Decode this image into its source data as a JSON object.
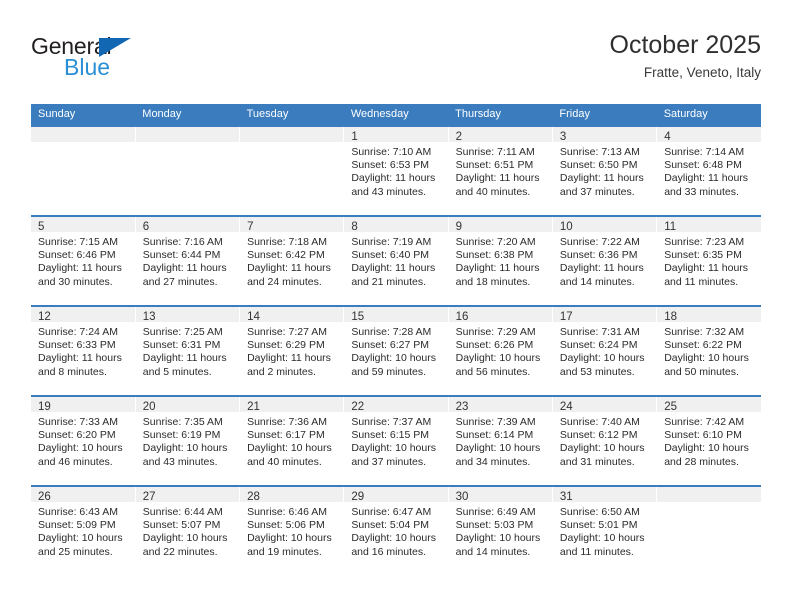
{
  "brand": {
    "name_part1": "General",
    "name_part2": "Blue",
    "triangle_icon": "brand-triangle-icon",
    "colors": {
      "dark": "#231f20",
      "blue": "#2a8fd4",
      "triangle": "#1267b2"
    }
  },
  "header": {
    "title": "October 2025",
    "subtitle": "Fratte, Veneto, Italy"
  },
  "theme": {
    "header_row_bg": "#3a7cbe",
    "daynum_band_bg": "#f0f0f0",
    "cell_bg": "#ffffff",
    "text": "#2b2b2b"
  },
  "weekday_headers": [
    "Sunday",
    "Monday",
    "Tuesday",
    "Wednesday",
    "Thursday",
    "Friday",
    "Saturday"
  ],
  "labels": {
    "sunrise_prefix": "Sunrise:",
    "sunset_prefix": "Sunset:",
    "daylight_prefix": "Daylight:"
  },
  "weeks": [
    [
      {
        "day": "",
        "empty": true,
        "l1": "",
        "l2": "",
        "l3": "",
        "l4": ""
      },
      {
        "day": "",
        "empty": true,
        "l1": "",
        "l2": "",
        "l3": "",
        "l4": ""
      },
      {
        "day": "",
        "empty": true,
        "l1": "",
        "l2": "",
        "l3": "",
        "l4": ""
      },
      {
        "day": "1",
        "empty": false,
        "l1": "Sunrise: 7:10 AM",
        "l2": "Sunset: 6:53 PM",
        "l3": "Daylight: 11 hours",
        "l4": "and 43 minutes."
      },
      {
        "day": "2",
        "empty": false,
        "l1": "Sunrise: 7:11 AM",
        "l2": "Sunset: 6:51 PM",
        "l3": "Daylight: 11 hours",
        "l4": "and 40 minutes."
      },
      {
        "day": "3",
        "empty": false,
        "l1": "Sunrise: 7:13 AM",
        "l2": "Sunset: 6:50 PM",
        "l3": "Daylight: 11 hours",
        "l4": "and 37 minutes."
      },
      {
        "day": "4",
        "empty": false,
        "l1": "Sunrise: 7:14 AM",
        "l2": "Sunset: 6:48 PM",
        "l3": "Daylight: 11 hours",
        "l4": "and 33 minutes."
      }
    ],
    [
      {
        "day": "5",
        "empty": false,
        "l1": "Sunrise: 7:15 AM",
        "l2": "Sunset: 6:46 PM",
        "l3": "Daylight: 11 hours",
        "l4": "and 30 minutes."
      },
      {
        "day": "6",
        "empty": false,
        "l1": "Sunrise: 7:16 AM",
        "l2": "Sunset: 6:44 PM",
        "l3": "Daylight: 11 hours",
        "l4": "and 27 minutes."
      },
      {
        "day": "7",
        "empty": false,
        "l1": "Sunrise: 7:18 AM",
        "l2": "Sunset: 6:42 PM",
        "l3": "Daylight: 11 hours",
        "l4": "and 24 minutes."
      },
      {
        "day": "8",
        "empty": false,
        "l1": "Sunrise: 7:19 AM",
        "l2": "Sunset: 6:40 PM",
        "l3": "Daylight: 11 hours",
        "l4": "and 21 minutes."
      },
      {
        "day": "9",
        "empty": false,
        "l1": "Sunrise: 7:20 AM",
        "l2": "Sunset: 6:38 PM",
        "l3": "Daylight: 11 hours",
        "l4": "and 18 minutes."
      },
      {
        "day": "10",
        "empty": false,
        "l1": "Sunrise: 7:22 AM",
        "l2": "Sunset: 6:36 PM",
        "l3": "Daylight: 11 hours",
        "l4": "and 14 minutes."
      },
      {
        "day": "11",
        "empty": false,
        "l1": "Sunrise: 7:23 AM",
        "l2": "Sunset: 6:35 PM",
        "l3": "Daylight: 11 hours",
        "l4": "and 11 minutes."
      }
    ],
    [
      {
        "day": "12",
        "empty": false,
        "l1": "Sunrise: 7:24 AM",
        "l2": "Sunset: 6:33 PM",
        "l3": "Daylight: 11 hours",
        "l4": "and 8 minutes."
      },
      {
        "day": "13",
        "empty": false,
        "l1": "Sunrise: 7:25 AM",
        "l2": "Sunset: 6:31 PM",
        "l3": "Daylight: 11 hours",
        "l4": "and 5 minutes."
      },
      {
        "day": "14",
        "empty": false,
        "l1": "Sunrise: 7:27 AM",
        "l2": "Sunset: 6:29 PM",
        "l3": "Daylight: 11 hours",
        "l4": "and 2 minutes."
      },
      {
        "day": "15",
        "empty": false,
        "l1": "Sunrise: 7:28 AM",
        "l2": "Sunset: 6:27 PM",
        "l3": "Daylight: 10 hours",
        "l4": "and 59 minutes."
      },
      {
        "day": "16",
        "empty": false,
        "l1": "Sunrise: 7:29 AM",
        "l2": "Sunset: 6:26 PM",
        "l3": "Daylight: 10 hours",
        "l4": "and 56 minutes."
      },
      {
        "day": "17",
        "empty": false,
        "l1": "Sunrise: 7:31 AM",
        "l2": "Sunset: 6:24 PM",
        "l3": "Daylight: 10 hours",
        "l4": "and 53 minutes."
      },
      {
        "day": "18",
        "empty": false,
        "l1": "Sunrise: 7:32 AM",
        "l2": "Sunset: 6:22 PM",
        "l3": "Daylight: 10 hours",
        "l4": "and 50 minutes."
      }
    ],
    [
      {
        "day": "19",
        "empty": false,
        "l1": "Sunrise: 7:33 AM",
        "l2": "Sunset: 6:20 PM",
        "l3": "Daylight: 10 hours",
        "l4": "and 46 minutes."
      },
      {
        "day": "20",
        "empty": false,
        "l1": "Sunrise: 7:35 AM",
        "l2": "Sunset: 6:19 PM",
        "l3": "Daylight: 10 hours",
        "l4": "and 43 minutes."
      },
      {
        "day": "21",
        "empty": false,
        "l1": "Sunrise: 7:36 AM",
        "l2": "Sunset: 6:17 PM",
        "l3": "Daylight: 10 hours",
        "l4": "and 40 minutes."
      },
      {
        "day": "22",
        "empty": false,
        "l1": "Sunrise: 7:37 AM",
        "l2": "Sunset: 6:15 PM",
        "l3": "Daylight: 10 hours",
        "l4": "and 37 minutes."
      },
      {
        "day": "23",
        "empty": false,
        "l1": "Sunrise: 7:39 AM",
        "l2": "Sunset: 6:14 PM",
        "l3": "Daylight: 10 hours",
        "l4": "and 34 minutes."
      },
      {
        "day": "24",
        "empty": false,
        "l1": "Sunrise: 7:40 AM",
        "l2": "Sunset: 6:12 PM",
        "l3": "Daylight: 10 hours",
        "l4": "and 31 minutes."
      },
      {
        "day": "25",
        "empty": false,
        "l1": "Sunrise: 7:42 AM",
        "l2": "Sunset: 6:10 PM",
        "l3": "Daylight: 10 hours",
        "l4": "and 28 minutes."
      }
    ],
    [
      {
        "day": "26",
        "empty": false,
        "l1": "Sunrise: 6:43 AM",
        "l2": "Sunset: 5:09 PM",
        "l3": "Daylight: 10 hours",
        "l4": "and 25 minutes."
      },
      {
        "day": "27",
        "empty": false,
        "l1": "Sunrise: 6:44 AM",
        "l2": "Sunset: 5:07 PM",
        "l3": "Daylight: 10 hours",
        "l4": "and 22 minutes."
      },
      {
        "day": "28",
        "empty": false,
        "l1": "Sunrise: 6:46 AM",
        "l2": "Sunset: 5:06 PM",
        "l3": "Daylight: 10 hours",
        "l4": "and 19 minutes."
      },
      {
        "day": "29",
        "empty": false,
        "l1": "Sunrise: 6:47 AM",
        "l2": "Sunset: 5:04 PM",
        "l3": "Daylight: 10 hours",
        "l4": "and 16 minutes."
      },
      {
        "day": "30",
        "empty": false,
        "l1": "Sunrise: 6:49 AM",
        "l2": "Sunset: 5:03 PM",
        "l3": "Daylight: 10 hours",
        "l4": "and 14 minutes."
      },
      {
        "day": "31",
        "empty": false,
        "l1": "Sunrise: 6:50 AM",
        "l2": "Sunset: 5:01 PM",
        "l3": "Daylight: 10 hours",
        "l4": "and 11 minutes."
      },
      {
        "day": "",
        "empty": true,
        "l1": "",
        "l2": "",
        "l3": "",
        "l4": ""
      }
    ]
  ]
}
